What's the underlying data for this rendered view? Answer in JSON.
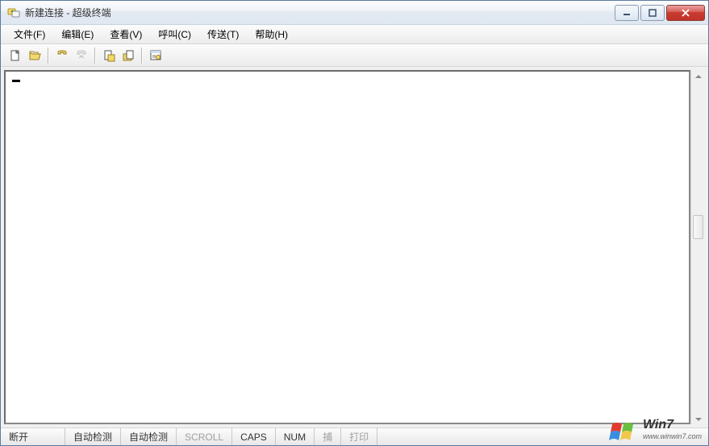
{
  "title": "新建连接 - 超级终端",
  "menu": {
    "file": "文件(F)",
    "edit": "编辑(E)",
    "view": "查看(V)",
    "call": "呼叫(C)",
    "transfer": "传送(T)",
    "help": "帮助(H)"
  },
  "status": {
    "connection": "断开",
    "detect1": "自动检测",
    "detect2": "自动检测",
    "scroll": "SCROLL",
    "caps": "CAPS",
    "num": "NUM",
    "capture": "捕",
    "print": "打印"
  },
  "watermark": {
    "brand": "Win7",
    "sub": "www.winwin7.com"
  }
}
